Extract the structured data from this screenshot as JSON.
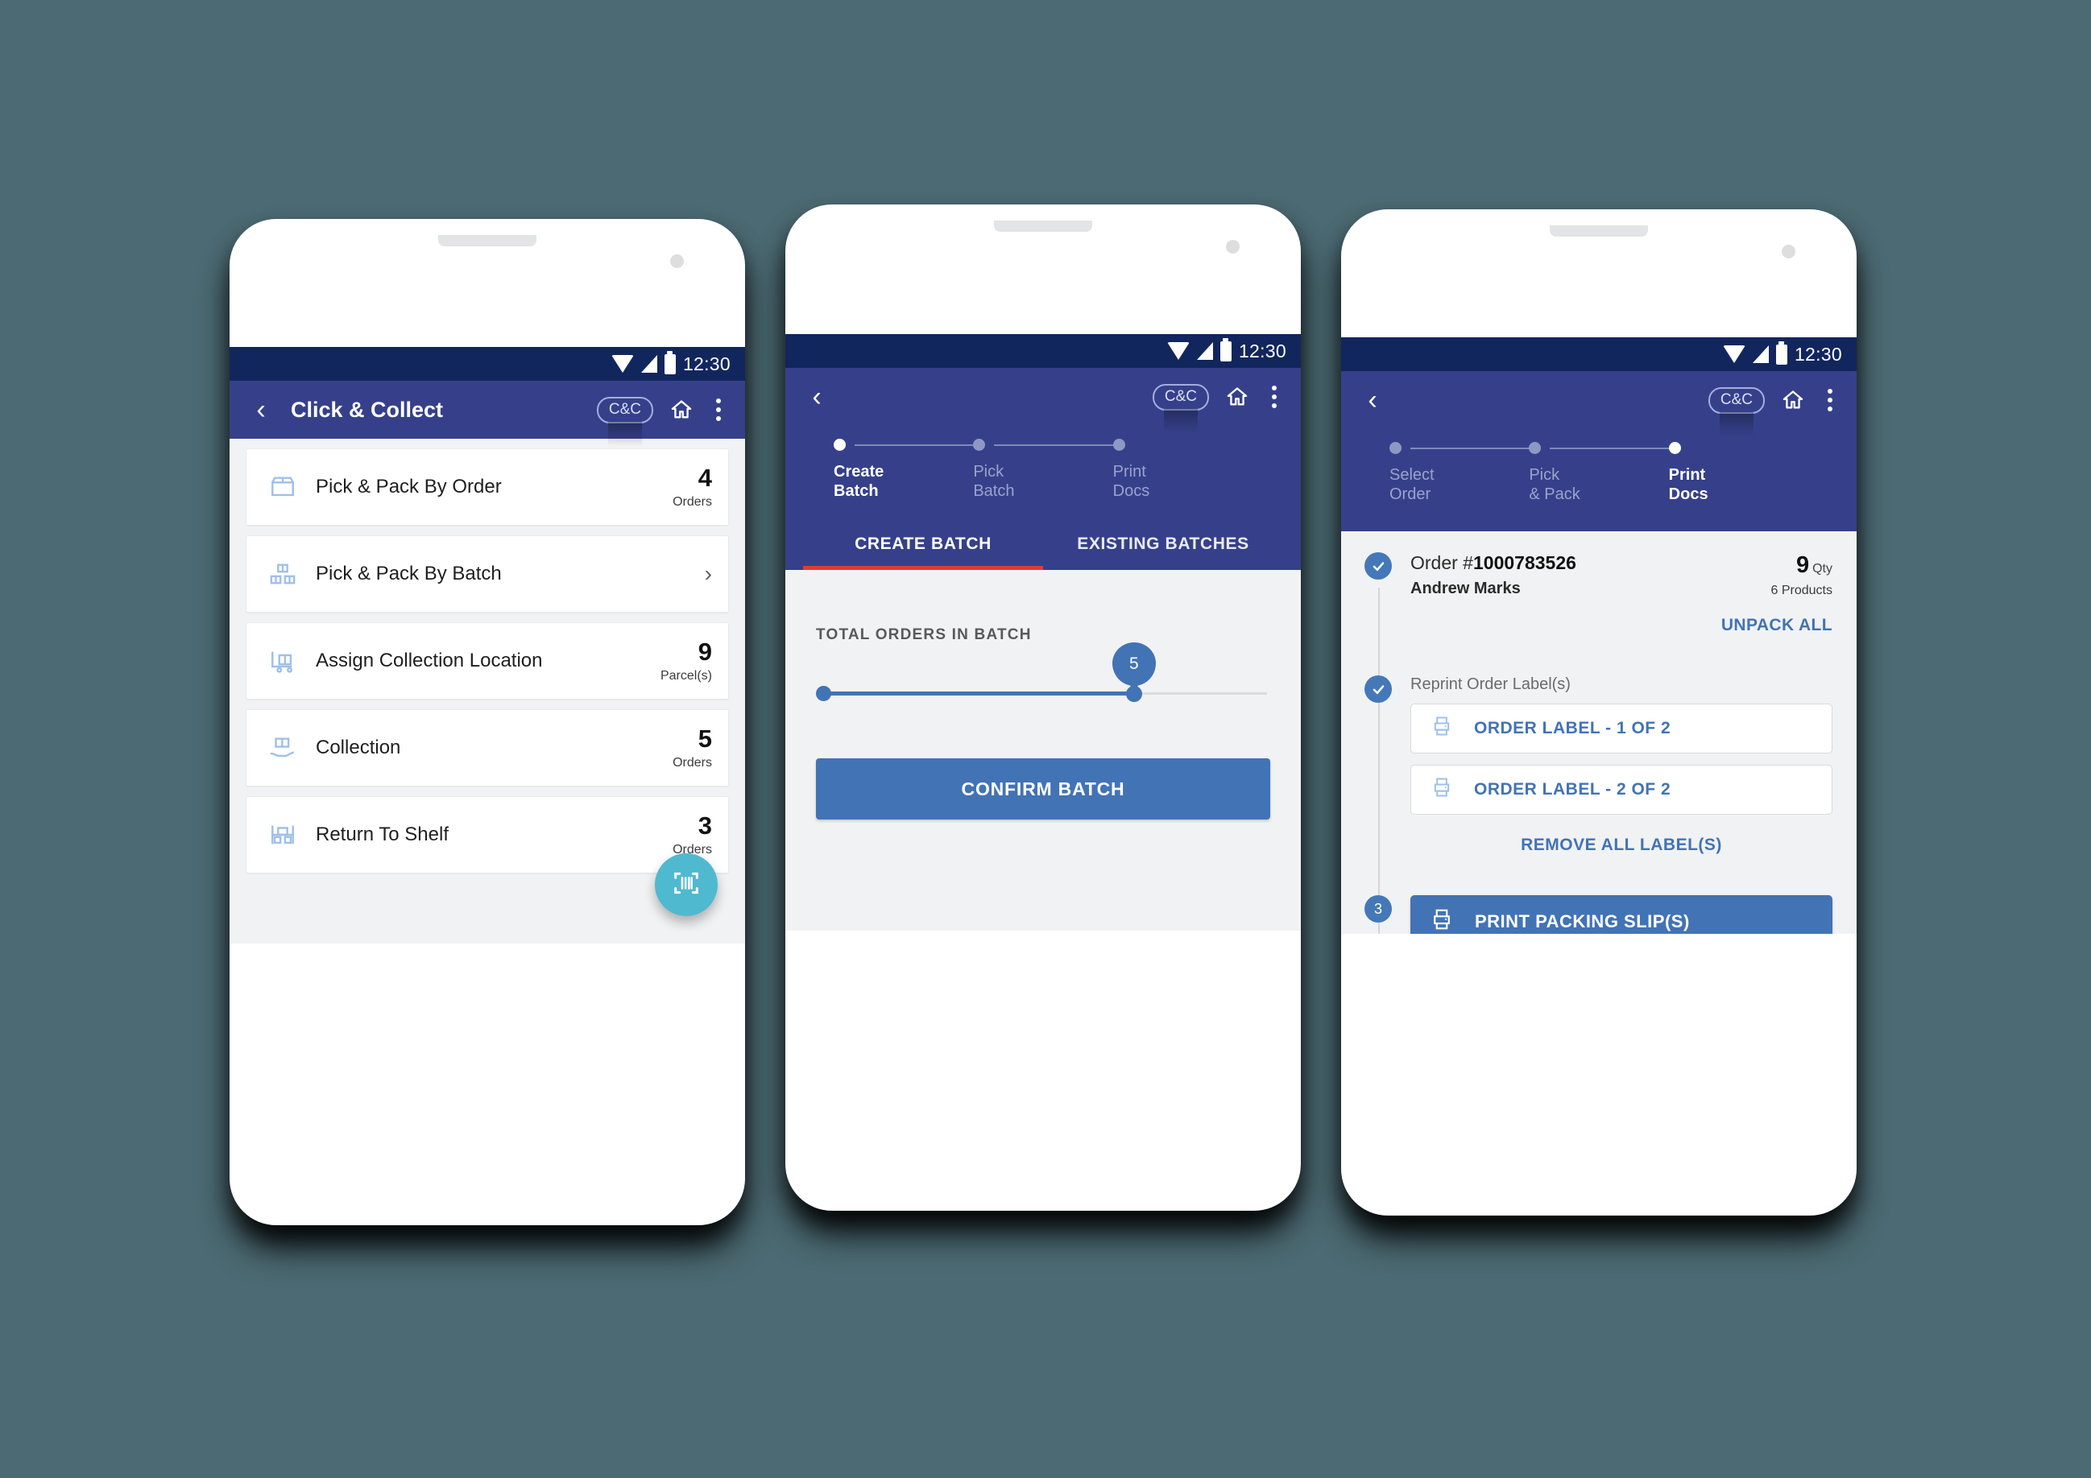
{
  "background_color": "#4c6a73",
  "theme": {
    "status_bar": "#12265e",
    "app_bar": "#36408a",
    "primary_blue": "#4273b5",
    "accent_teal": "#4fb9d0",
    "tab_indicator_red": "#e23b31",
    "icon_light_blue": "#9ec0ea"
  },
  "status_bar": {
    "time": "12:30"
  },
  "phone1": {
    "app_bar": {
      "back_icon": "chevron-left-icon",
      "title": "Click & Collect",
      "badge": "C&C",
      "home_icon": "home-icon",
      "overflow_icon": "more-vertical-icon"
    },
    "list": [
      {
        "icon": "box-icon",
        "label": "Pick & Pack By Order",
        "value": "4",
        "unit": "Orders",
        "chevron": false
      },
      {
        "icon": "boxes-icon",
        "label": "Pick & Pack By Batch",
        "value": "",
        "unit": "",
        "chevron": true,
        "chevron_glyph": "›"
      },
      {
        "icon": "pallet-truck-icon",
        "label": "Assign Collection Location",
        "value": "9",
        "unit": "Parcel(s)",
        "chevron": false
      },
      {
        "icon": "handover-icon",
        "label": "Collection",
        "value": "5",
        "unit": "Orders",
        "chevron": false
      },
      {
        "icon": "shelf-icon",
        "label": "Return To Shelf",
        "value": "3",
        "unit": "Orders",
        "chevron": false
      }
    ],
    "fab": {
      "icon": "barcode-scan-icon"
    }
  },
  "phone2": {
    "app_bar": {
      "back_icon": "chevron-left-icon",
      "badge": "C&C",
      "home_icon": "home-icon",
      "overflow_icon": "more-vertical-icon"
    },
    "stepper": [
      {
        "label": "Create\nBatch",
        "active": true
      },
      {
        "label": "Pick\nBatch",
        "active": false
      },
      {
        "label": "Print\nDocs",
        "active": false
      }
    ],
    "tabs": [
      {
        "label": "CREATE BATCH",
        "active": true
      },
      {
        "label": "EXISTING BATCHES",
        "active": false
      }
    ],
    "slider": {
      "label": "TOTAL ORDERS IN BATCH",
      "value": "5",
      "min": 0,
      "max": 7,
      "fill_percent": 70
    },
    "confirm_button": "CONFIRM BATCH"
  },
  "phone3": {
    "app_bar": {
      "back_icon": "chevron-left-icon",
      "badge": "C&C",
      "home_icon": "home-icon",
      "overflow_icon": "more-vertical-icon"
    },
    "stepper": [
      {
        "label": "Select\nOrder",
        "active": false
      },
      {
        "label": "Pick\n& Pack",
        "active": false
      },
      {
        "label": "Print\nDocs",
        "active": true
      }
    ],
    "order": {
      "prefix": "Order #",
      "number": "1000783526",
      "customer": "Andrew Marks",
      "qty": "9",
      "qty_unit": "Qty",
      "products": "6 Products",
      "unpack_all": "UNPACK ALL",
      "marker": "check-icon"
    },
    "reprint": {
      "section_label": "Reprint Order Label(s)",
      "marker": "check-icon",
      "labels": [
        {
          "icon": "printer-icon",
          "text": "ORDER LABEL - 1 OF 2"
        },
        {
          "icon": "printer-icon",
          "text": "ORDER LABEL - 2 OF 2"
        }
      ],
      "remove_all": "REMOVE ALL LABEL(S)"
    },
    "packing": {
      "marker": "3",
      "icon": "printer-icon",
      "label": "PRINT PACKING SLIP(S)"
    }
  }
}
